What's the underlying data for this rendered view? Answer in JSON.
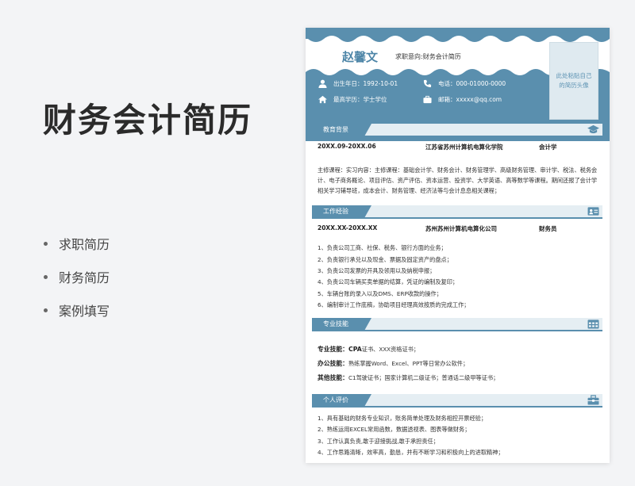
{
  "slide": {
    "title": "财务会计简历",
    "bullets": [
      "求职简历",
      "财务简历",
      "案例填写"
    ]
  },
  "resume": {
    "name": "赵馨文",
    "intent": "求职意向:财务会计简历",
    "photo_text": "此处粘贴自己的简历头像",
    "birth": "出生年日：1992-10-01",
    "phone": "电话：000-01000-0000",
    "education_level": "最高学历：学士学位",
    "email": "邮箱：xxxxx@qq.com",
    "sections": {
      "education": {
        "label": "教育背景",
        "date": "20XX.09-20XX.06",
        "school": "江苏省苏州计算机电算化学院",
        "major": "会计学",
        "courses": "主修课程：实习内容：主修课程：基础会计学、财务会计、财务管理学、高级财务管理、审计学、税法、税务会计、电子商务概论、项目评估、资产评估、资本运营、投资学、大学英语、高等数学等课程。期间还报了会计学相关学习辅导班，成本会计、财务管理、经济法等与会计息息相关课程；"
      },
      "work": {
        "label": "工作经验",
        "date": "20XX.XX-20XX.XX",
        "company": "苏州苏州计算机电算化公司",
        "position": "财务员",
        "items": [
          "1、负责公司工商、社保、税务、银行方面的业务；",
          "2、负责银行承兑以及现金、票据及固定资产的盘点；",
          "3、负责公司发票的开具及领用以及纳税申报；",
          "4、负责公司车辆买卖单据的结算，凭证的编制及复印；",
          "5、车辆台账的录入以及DMS、ERP收款的操作；",
          "6、编制审计工作底稿，协助项目经理高效按质的完成工作；"
        ]
      },
      "skills": {
        "label": "专业技能",
        "items": [
          {
            "name": "专业技能：",
            "bold": "CPA",
            "text": "证书、XXX资格证书；"
          },
          {
            "name": "办公技能：",
            "bold": "",
            "text": "熟练掌握Word、Excel、PPT等日常办公软件；"
          },
          {
            "name": "其他技能：",
            "bold": "",
            "text": "C1驾驶证书；国家计算机二级证书；普通话二级甲等证书；"
          }
        ]
      },
      "evaluation": {
        "label": "个人评价",
        "items": [
          "1、具有基础的财务专业知识，账务简单处理及财务相控开票经验；",
          "2、熟练运用EXCEL常用函数，数据透视表、图表等做财务；",
          "3、工作认真负责,敢于迎接挑战,敢于承担责任；",
          "4、工作思路清晰，效率高，勤恳，并有不断学习和积极向上的进取精神；"
        ]
      }
    }
  },
  "colors": {
    "accent": "#5a8fae",
    "light": "#e5eef3",
    "name": "#4d85a7"
  },
  "icons": [
    "user-icon",
    "phone-icon",
    "graduation-icon",
    "briefcase-icon",
    "graduation-cap-icon",
    "id-card-icon",
    "calendar-icon",
    "toolbox-icon"
  ]
}
